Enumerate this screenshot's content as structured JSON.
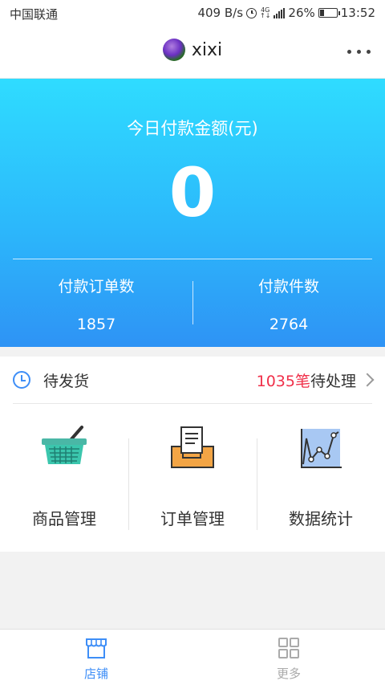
{
  "status_bar": {
    "carrier": "中国联通",
    "speed": "409 B/s",
    "network": "4G",
    "battery": "26%",
    "battery_level": 0.26,
    "time": "13:52"
  },
  "header": {
    "shop_name": "xixi"
  },
  "summary": {
    "amount_label": "今日付款金额(元)",
    "amount_value": "0",
    "orders_label": "付款订单数",
    "orders_value": "1857",
    "items_label": "付款件数",
    "items_value": "2764"
  },
  "pending": {
    "label": "待发货",
    "count": "1035笔",
    "suffix": "待处理"
  },
  "menu": {
    "items": [
      {
        "label": "商品管理",
        "icon": "basket-icon"
      },
      {
        "label": "订单管理",
        "icon": "inbox-document-icon"
      },
      {
        "label": "数据统计",
        "icon": "line-chart-icon"
      }
    ]
  },
  "tabs": [
    {
      "label": "店铺",
      "icon": "store-icon",
      "active": true,
      "color": "#3e8ef7"
    },
    {
      "label": "更多",
      "icon": "grid-icon",
      "active": false,
      "color": "#aaaaaa"
    }
  ]
}
